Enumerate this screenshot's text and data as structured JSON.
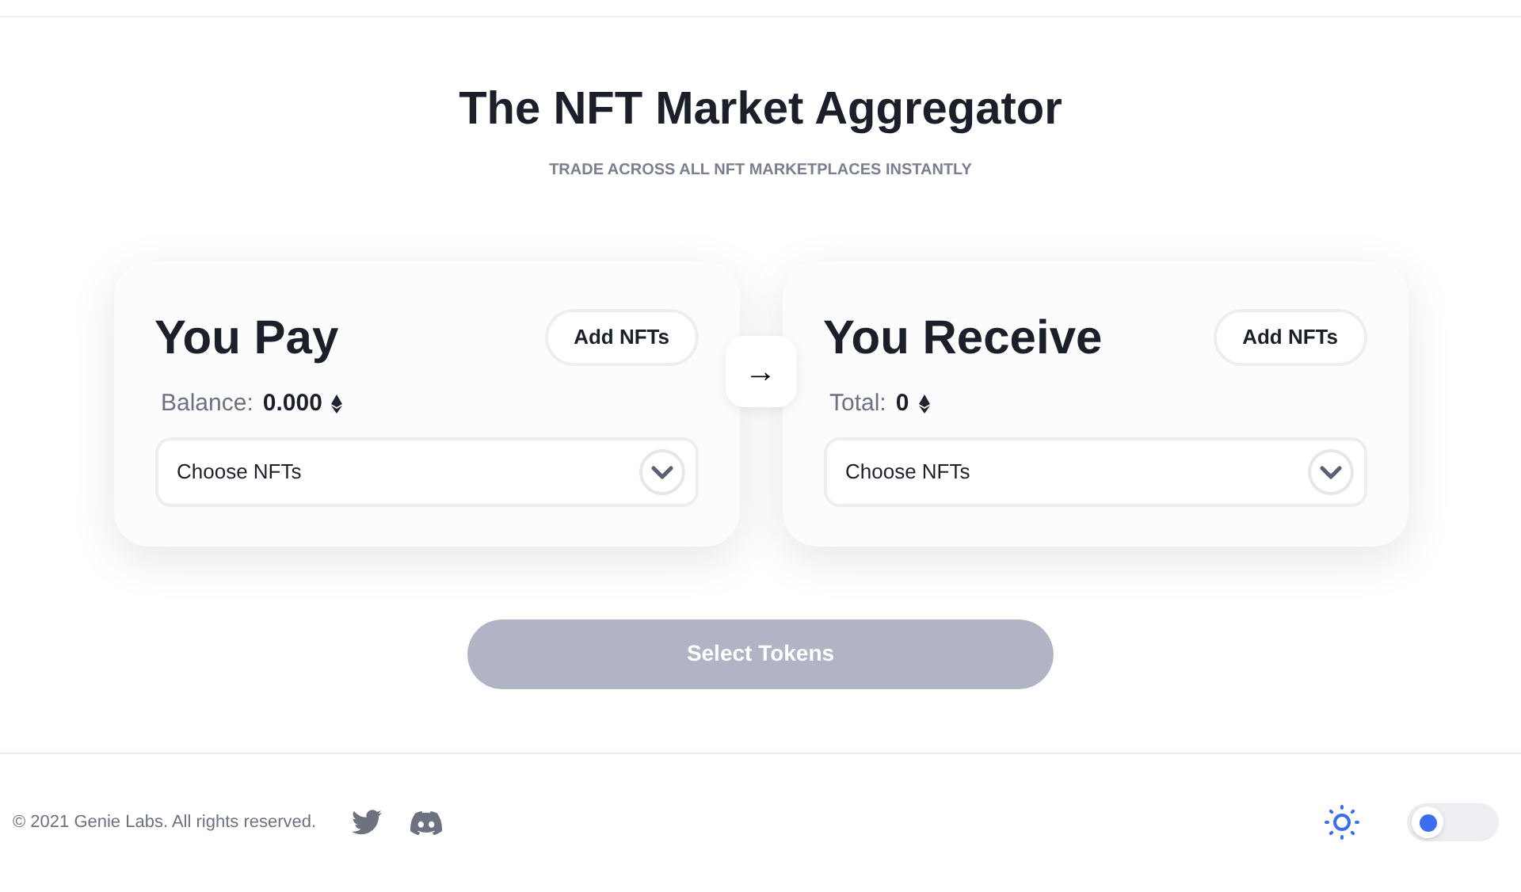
{
  "header": {
    "title": "The NFT Market Aggregator",
    "subtitle": "TRADE ACROSS ALL NFT MARKETPLACES INSTANTLY"
  },
  "panels": [
    {
      "title": "You Pay",
      "add_button": "Add NFTs",
      "stat_label": "Balance:",
      "stat_value": "0.000",
      "select_placeholder": "Choose NFTs"
    },
    {
      "title": "You Receive",
      "add_button": "Add NFTs",
      "stat_label": "Total:",
      "stat_value": "0",
      "select_placeholder": "Choose NFTs"
    }
  ],
  "swap_arrow": "→",
  "action_button": {
    "label": "Select Tokens",
    "disabled": true
  },
  "footer": {
    "copyright": "© 2021 Genie Labs. All rights reserved.",
    "theme_toggle": {
      "on": false
    }
  }
}
